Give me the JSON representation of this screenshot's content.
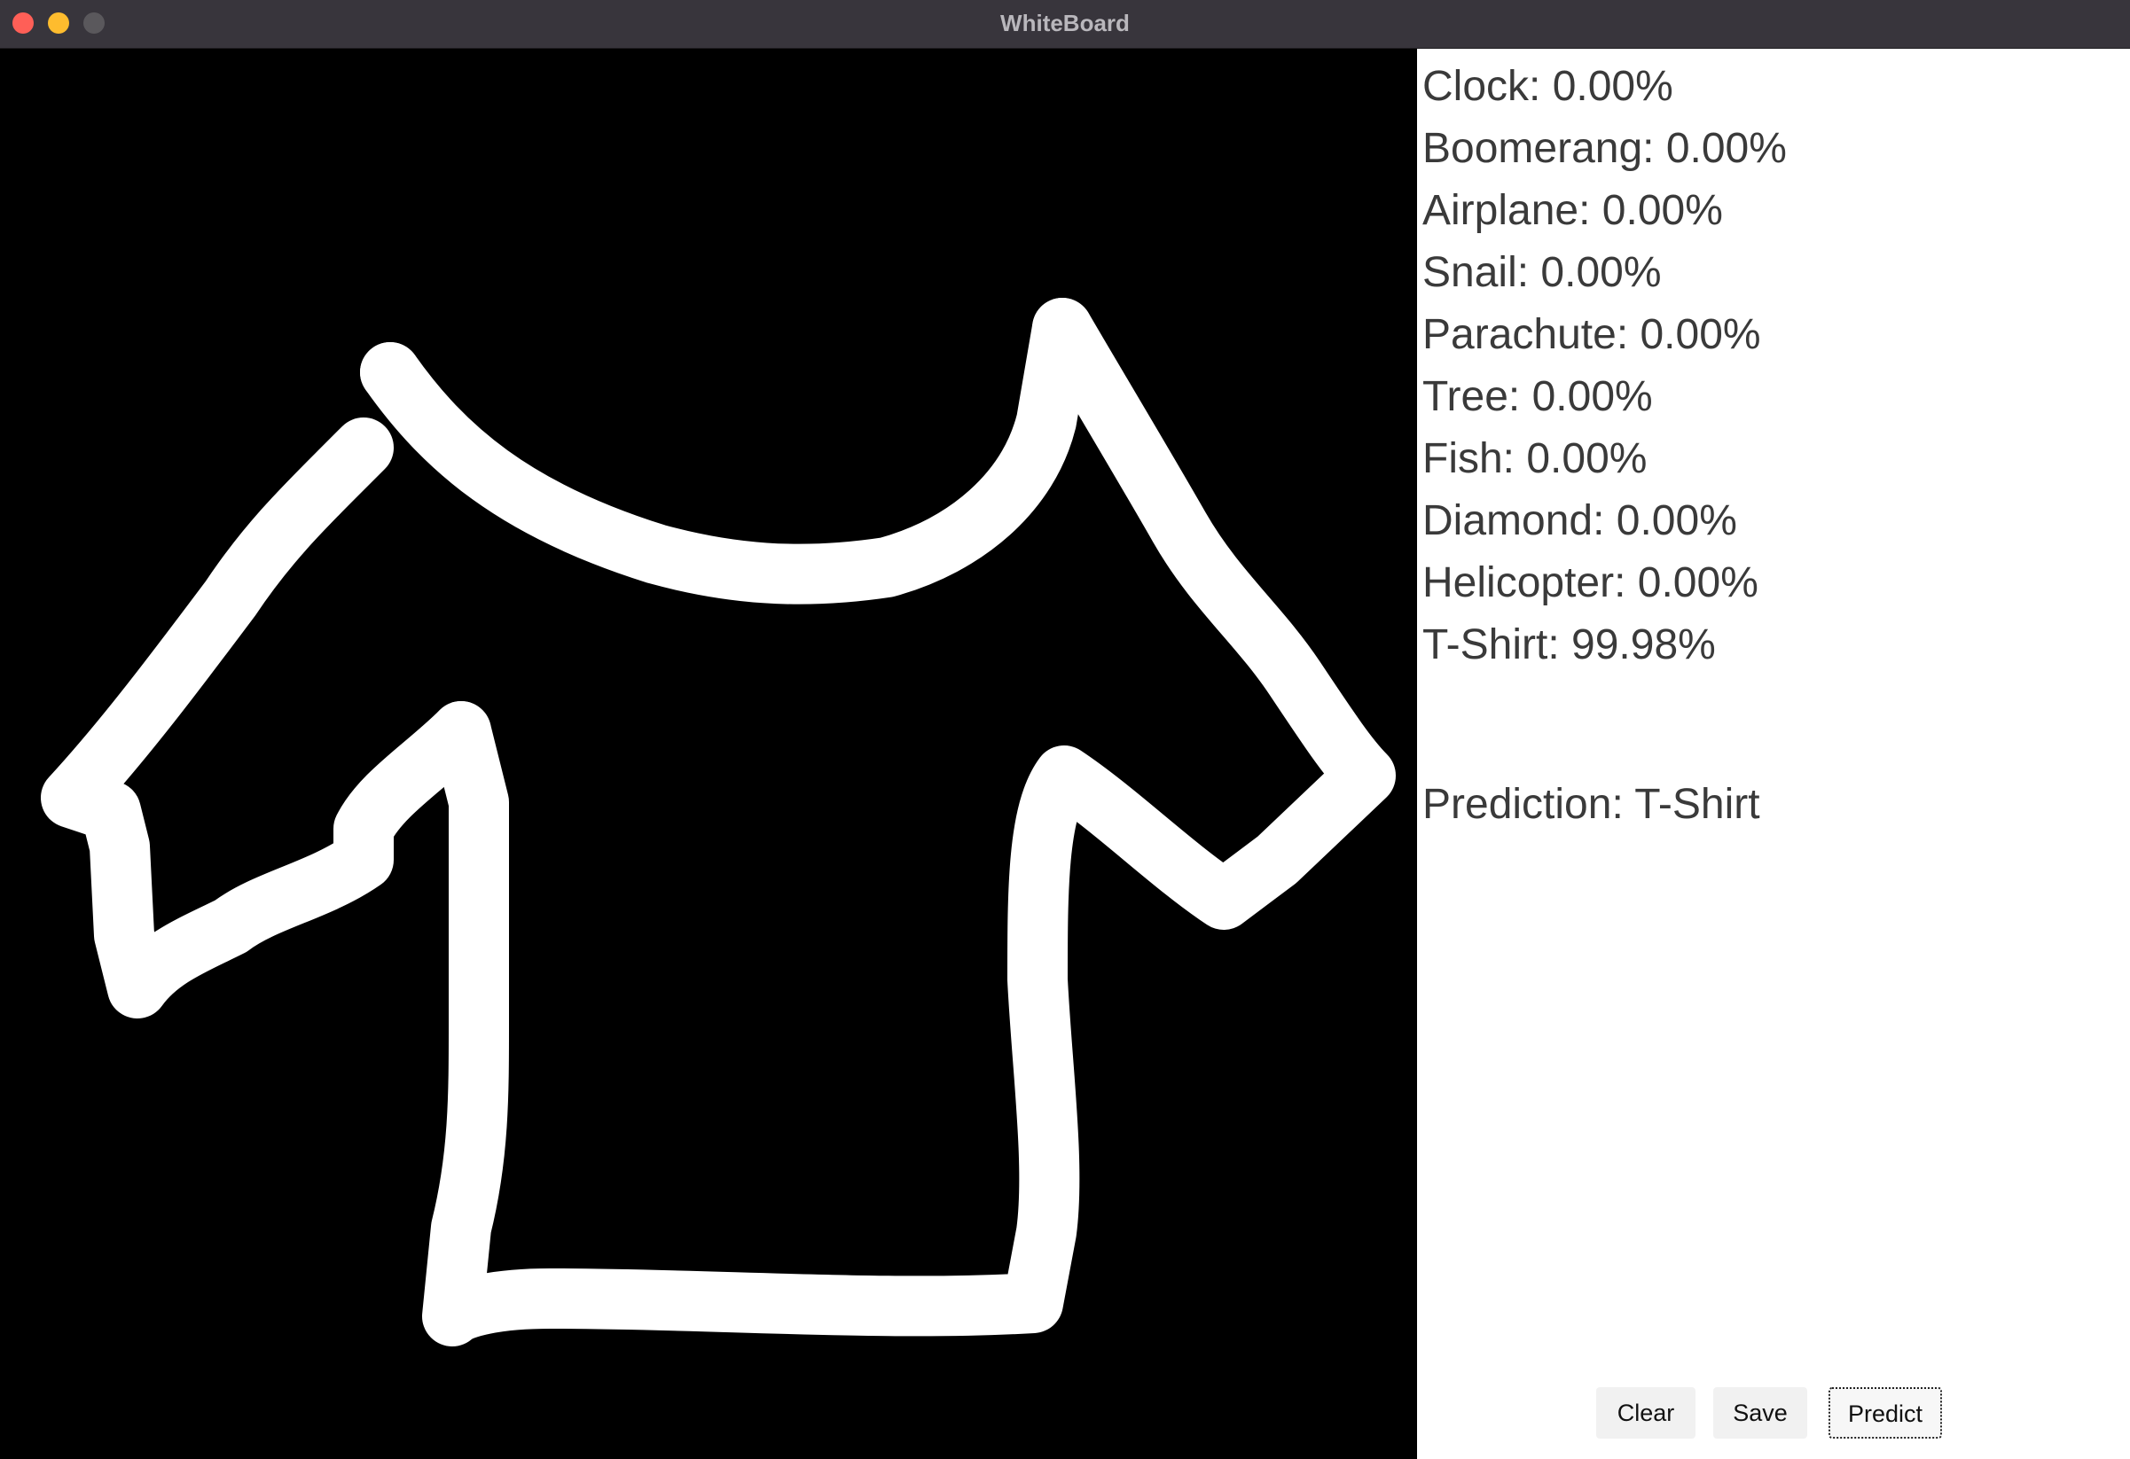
{
  "window": {
    "title": "WhiteBoard"
  },
  "colors": {
    "titlebar": "#38353c",
    "close": "#ff5f57",
    "minimize": "#febc2e",
    "zoom": "#5a585c",
    "canvas_background": "#000000",
    "stroke": "#ffffff",
    "text": "#3a3a3a"
  },
  "drawing": {
    "subject": "t-shirt sketch"
  },
  "scores": [
    {
      "label": "Clock: 0.00%"
    },
    {
      "label": "Boomerang: 0.00%"
    },
    {
      "label": "Airplane: 0.00%"
    },
    {
      "label": "Snail: 0.00%"
    },
    {
      "label": "Parachute: 0.00%"
    },
    {
      "label": "Tree: 0.00%"
    },
    {
      "label": "Fish: 0.00%"
    },
    {
      "label": "Diamond: 0.00%"
    },
    {
      "label": "Helicopter: 0.00%"
    },
    {
      "label": "T-Shirt: 99.98%"
    }
  ],
  "prediction": {
    "text": "Prediction: T-Shirt"
  },
  "buttons": {
    "clear": "Clear",
    "save": "Save",
    "predict": "Predict"
  }
}
